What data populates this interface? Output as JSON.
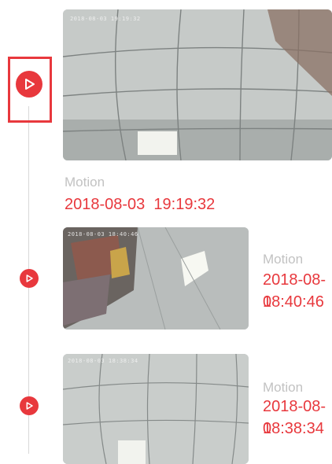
{
  "events": [
    {
      "osd": "2018-08-03 19:19:32",
      "type": "Motion",
      "time": "2018-08-03  19:19:32"
    },
    {
      "osd": "2018-08-03 18:40:46",
      "type": "Motion",
      "date": "2018-08-0",
      "clock": "18:40:46"
    },
    {
      "osd": "2018-08-03 18:38:34",
      "type": "Motion",
      "date": "2018-08-0",
      "clock": "18:38:34"
    }
  ],
  "colors": {
    "accent": "#e8383d",
    "muted": "#c2c2c2",
    "line": "#d9d9d9"
  },
  "icons": {
    "play": "play-icon"
  }
}
